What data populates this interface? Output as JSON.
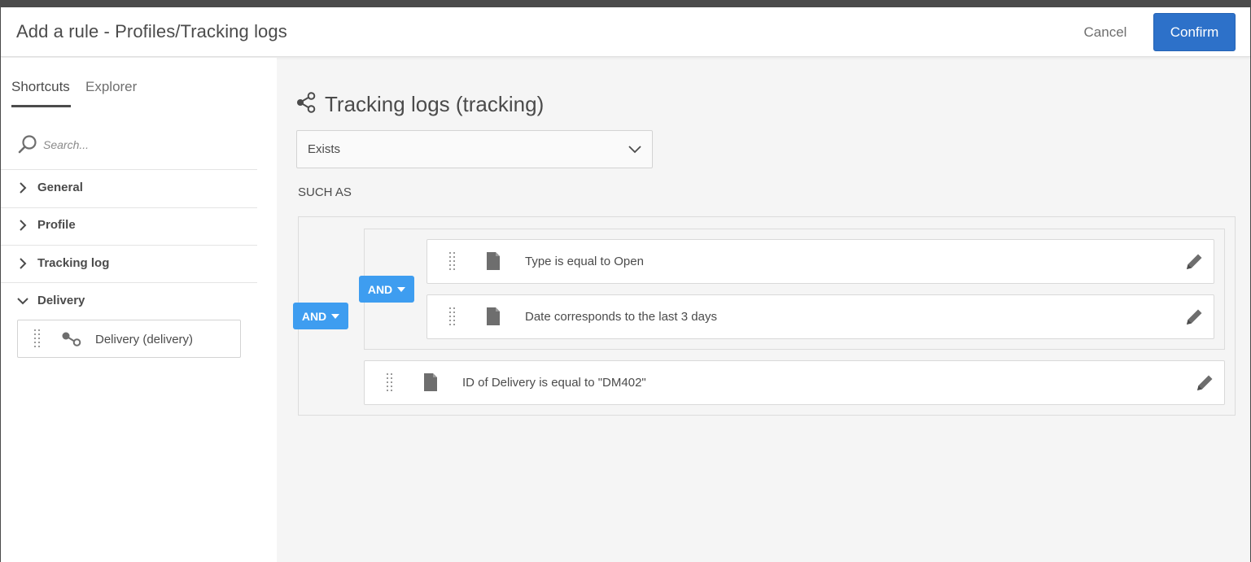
{
  "dialog": {
    "title": "Add a rule - Profiles/Tracking logs",
    "cancel_label": "Cancel",
    "confirm_label": "Confirm"
  },
  "sidebar": {
    "tabs": [
      {
        "label": "Shortcuts",
        "active": true
      },
      {
        "label": "Explorer",
        "active": false
      }
    ],
    "search_placeholder": "Search...",
    "items": [
      {
        "label": "General",
        "expanded": false
      },
      {
        "label": "Profile",
        "expanded": false
      },
      {
        "label": "Tracking log",
        "expanded": false
      },
      {
        "label": "Delivery",
        "expanded": true,
        "children": [
          {
            "label": "Delivery (delivery)",
            "icon": "link-icon"
          }
        ]
      }
    ]
  },
  "main": {
    "title": "Tracking logs (tracking)",
    "title_icon": "share-link-icon",
    "operator": "Exists",
    "such_as_label": "SUCH AS",
    "outer_and_label": "AND",
    "inner_and_label": "AND",
    "conditions_inner": [
      {
        "label": "Type is equal to Open",
        "icon": "document-icon"
      },
      {
        "label": "Date corresponds to the last 3 days",
        "icon": "document-icon"
      }
    ],
    "conditions_outer": [
      {
        "label": "ID of Delivery is equal to \"DM402\"",
        "icon": "document-icon"
      }
    ]
  },
  "colors": {
    "confirm_blue": "#2d71c9",
    "and_blue": "#3e9df0",
    "panel_bg": "#f5f5f5",
    "text": "#4b4b4b"
  }
}
